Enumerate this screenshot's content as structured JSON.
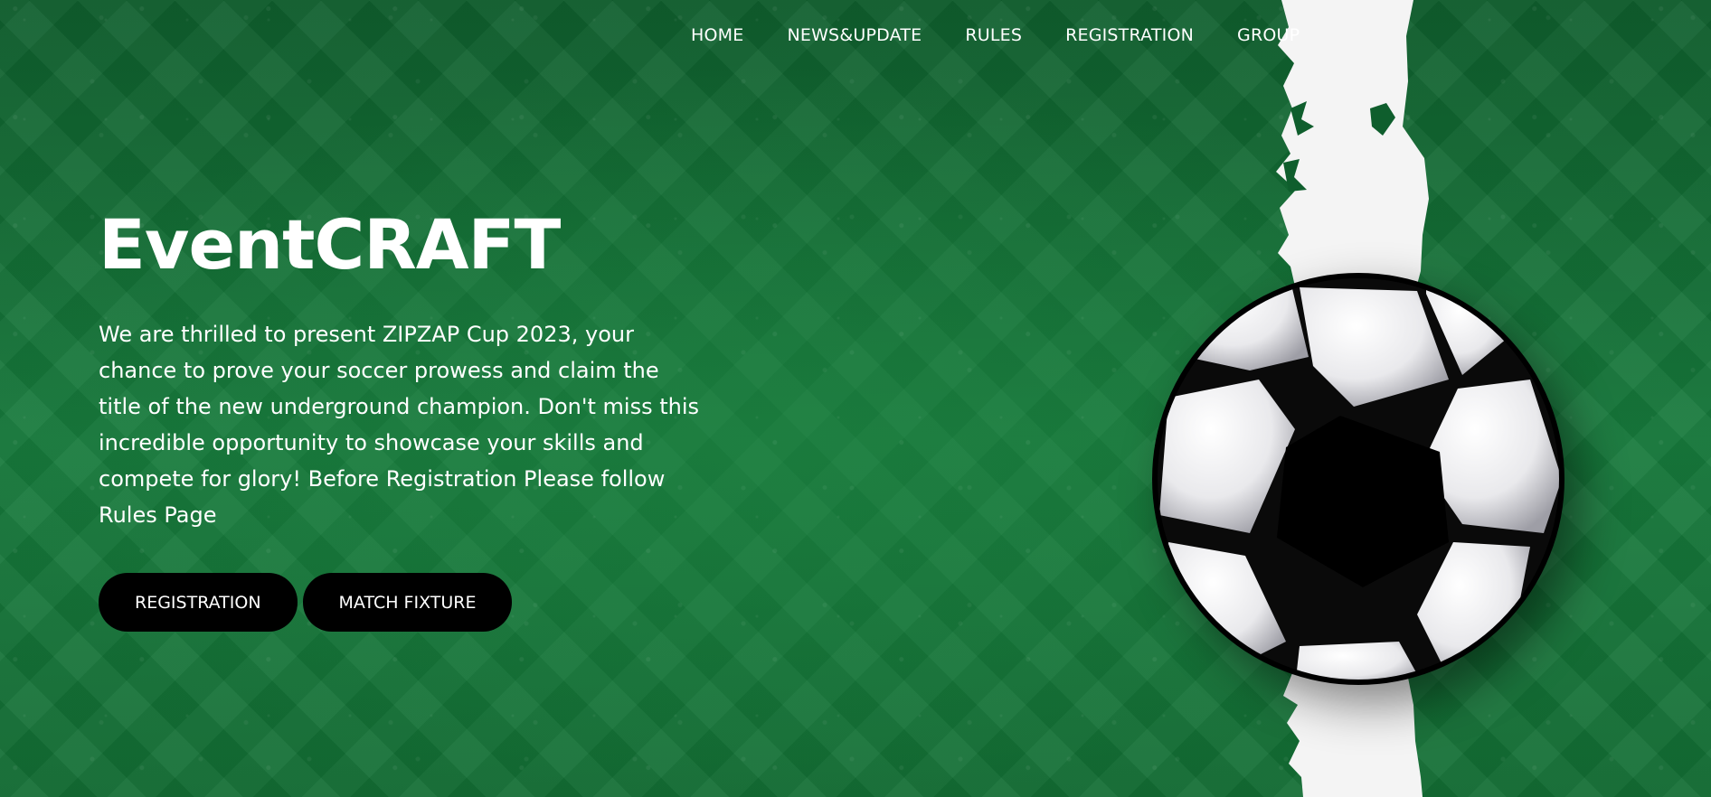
{
  "nav": {
    "items": [
      {
        "label": "HOME"
      },
      {
        "label": "NEWS&UPDATE"
      },
      {
        "label": "RULES"
      },
      {
        "label": "REGISTRATION"
      },
      {
        "label": "GROUP"
      }
    ]
  },
  "hero": {
    "title": "EventCRAFT",
    "description": "We are thrilled to present ZIPZAP Cup 2023, your chance to prove your soccer prowess and claim the title of the new underground champion. Don't miss this incredible opportunity to showcase your skills and compete for glory! Before Registration Please follow Rules Page",
    "buttons": {
      "registration": "REGISTRATION",
      "match_fixture": "MATCH FIXTURE"
    }
  },
  "colors": {
    "background": "#177a3c",
    "button": "#000000",
    "text": "#ffffff",
    "strip": "#f4f4f4"
  },
  "icons": {
    "ball": "soccer-ball-icon"
  }
}
